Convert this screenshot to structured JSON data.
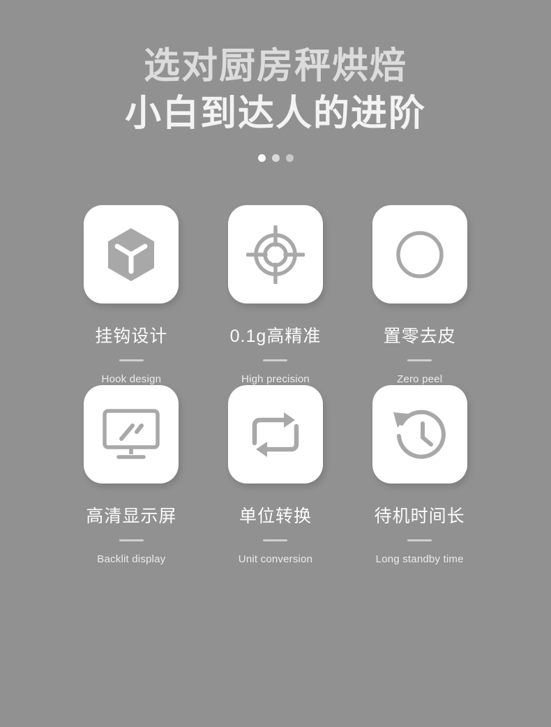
{
  "hero": {
    "line1": "选对厨房秤烘焙",
    "line2": "小白到达人的进阶",
    "dots": [
      "dot-bright",
      "dot-mid",
      "dot-dim"
    ]
  },
  "colors": {
    "background": "#919191",
    "card": "#ffffff",
    "icon": "#a8a8a8",
    "title_line1": "#dcdcdc",
    "title_line2": "#f3f3f3",
    "feature_title": "#fcfcfc",
    "feature_sub": "#ebebeb",
    "divider": "#cfcfcf"
  },
  "features": [
    {
      "icon": "cube-icon",
      "title": "挂钩设计",
      "sub": "Hook design"
    },
    {
      "icon": "crosshair-icon",
      "title": "0.1g高精准",
      "sub": "High precision"
    },
    {
      "icon": "circle-icon",
      "title": "置零去皮",
      "sub": "Zero peel"
    },
    {
      "icon": "monitor-icon",
      "title": "高清显示屏",
      "sub": "Backlit display"
    },
    {
      "icon": "repeat-icon",
      "title": "单位转换",
      "sub": "Unit conversion"
    },
    {
      "icon": "clock-history-icon",
      "title": "待机时间长",
      "sub": "Long standby time"
    }
  ]
}
